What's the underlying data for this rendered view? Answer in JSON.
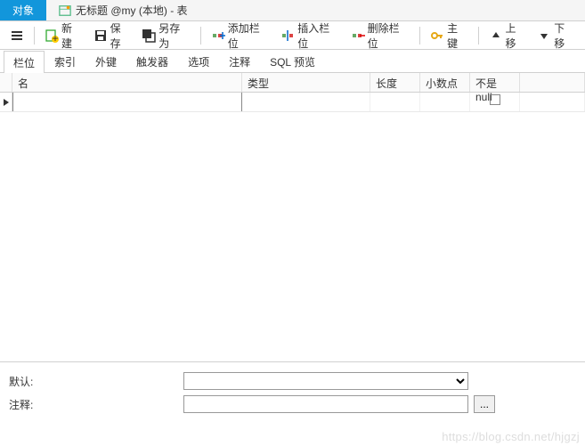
{
  "tabs": {
    "object_label": "对象",
    "untitled_label": "无标题 @my (本地) - 表"
  },
  "toolbar": {
    "new_label": "新建",
    "save_label": "保存",
    "saveas_label": "另存为",
    "addfield_label": "添加栏位",
    "insertfield_label": "插入栏位",
    "deletefield_label": "删除栏位",
    "primarykey_label": "主键",
    "moveup_label": "上移",
    "movedown_label": "下移"
  },
  "subtabs": {
    "fields": "栏位",
    "index": "索引",
    "fk": "外键",
    "trigger": "触发器",
    "options": "选项",
    "comment": "注释",
    "sqlpreview": "SQL 预览"
  },
  "grid": {
    "name": "名",
    "type": "类型",
    "length": "长度",
    "decimals": "小数点",
    "notnull": "不是 null"
  },
  "bottom": {
    "default_label": "默认:",
    "comment_label": "注释:",
    "default_value": "",
    "comment_value": "",
    "dots": "..."
  },
  "watermark": "https://blog.csdn.net/hjgzj"
}
